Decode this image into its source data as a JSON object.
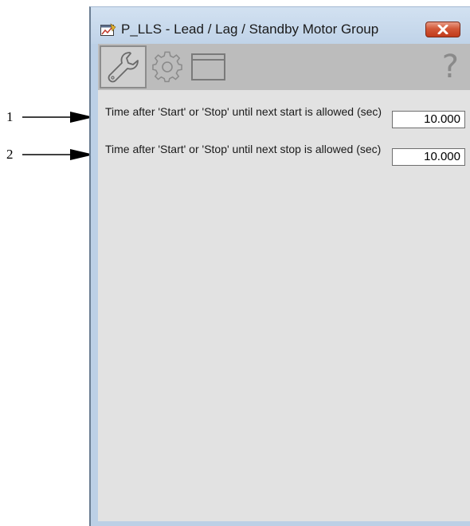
{
  "callouts": [
    {
      "number": "1"
    },
    {
      "number": "2"
    }
  ],
  "window": {
    "title": "P_LLS - Lead / Lag / Standby Motor Group",
    "app_icon": "faceplate-app-icon",
    "close_icon": "close-icon"
  },
  "toolbar": {
    "tabs": [
      {
        "icon": "wrench-icon",
        "selected": true
      },
      {
        "icon": "gear-icon",
        "selected": false
      },
      {
        "icon": "window-icon",
        "selected": false
      }
    ],
    "help_label": "?"
  },
  "parameters": [
    {
      "label": "Time after 'Start' or 'Stop' until next start is allowed (sec)",
      "value": "10.000"
    },
    {
      "label": "Time after 'Start' or 'Stop' until next stop is allowed (sec)",
      "value": "10.000"
    }
  ],
  "colors": {
    "close_button": "#c94a2a",
    "toolbar_bg": "#bcbcbc",
    "panel_bg": "#e2e2e2",
    "frame": "#bcd0e6"
  }
}
